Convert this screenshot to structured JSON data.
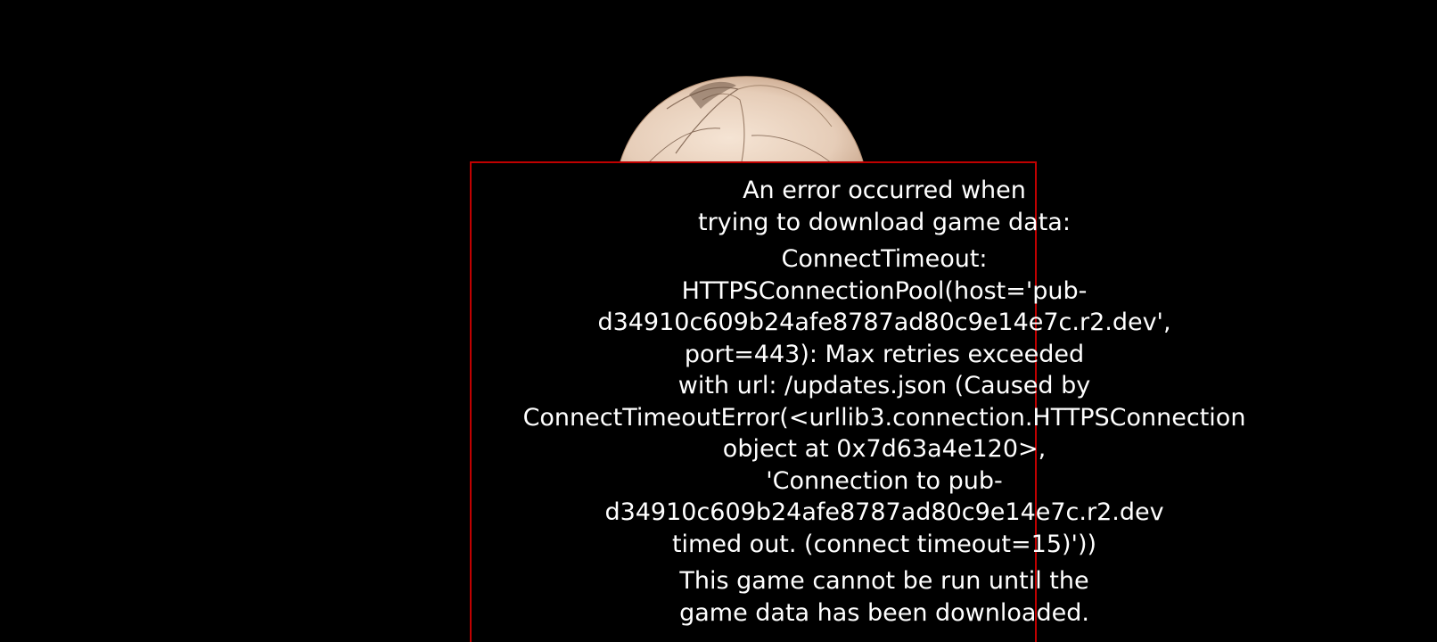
{
  "colors": {
    "background": "#000000",
    "frame_border": "#c00000",
    "text": "#ffffff",
    "logo_base": "#e9d3c0"
  },
  "logo": {
    "icon": "game-logo-emblem"
  },
  "error": {
    "heading": [
      "An error occurred when",
      "trying to download game data:"
    ],
    "details": [
      "ConnectTimeout:",
      "HTTPSConnectionPool(host='pub-",
      "d34910c609b24afe8787ad80c9e14e7c.r2.dev',",
      "port=443): Max retries exceeded",
      "with url: /updates.json (Caused by",
      "ConnectTimeoutError(<urllib3.connection.HTTPSConnection",
      "object at 0x7d63a4e120>,",
      "'Connection to pub-",
      "d34910c609b24afe8787ad80c9e14e7c.r2.dev",
      "timed out. (connect timeout=15)'))"
    ],
    "footer": [
      "This game cannot be run until the",
      "game data has been downloaded."
    ]
  }
}
